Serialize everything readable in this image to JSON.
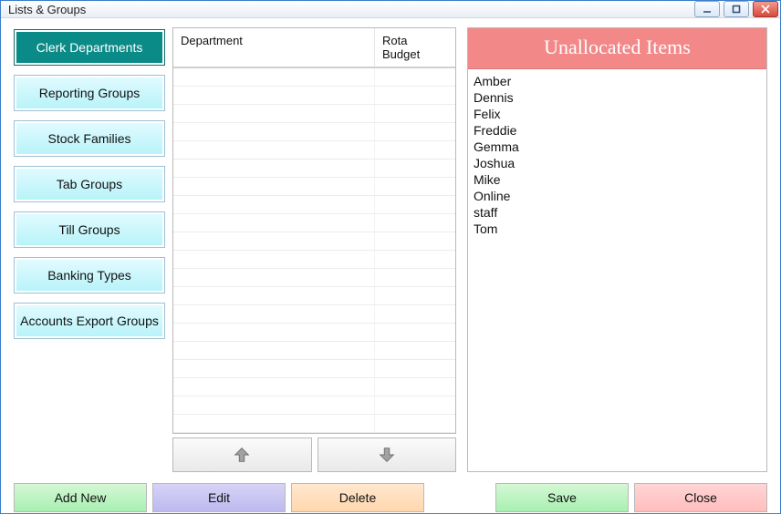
{
  "window": {
    "title": "Lists & Groups"
  },
  "nav": {
    "items": [
      {
        "label": "Clerk Departments",
        "selected": true
      },
      {
        "label": "Reporting Groups",
        "selected": false
      },
      {
        "label": "Stock Families",
        "selected": false
      },
      {
        "label": "Tab Groups",
        "selected": false
      },
      {
        "label": "Till Groups",
        "selected": false
      },
      {
        "label": "Banking Types",
        "selected": false
      },
      {
        "label": "Accounts Export Groups",
        "selected": false
      }
    ]
  },
  "grid": {
    "columns": {
      "col1": "Department",
      "col2": "Rota Budget"
    },
    "rows": []
  },
  "unallocated": {
    "title": "Unallocated Items",
    "items": [
      "Amber",
      "Dennis",
      "Felix",
      "Freddie",
      "Gemma",
      "Joshua",
      "Mike",
      "Online",
      "staff",
      "Tom"
    ]
  },
  "buttons": {
    "add": "Add New",
    "edit": "Edit",
    "delete": "Delete",
    "save": "Save",
    "close": "Close"
  }
}
